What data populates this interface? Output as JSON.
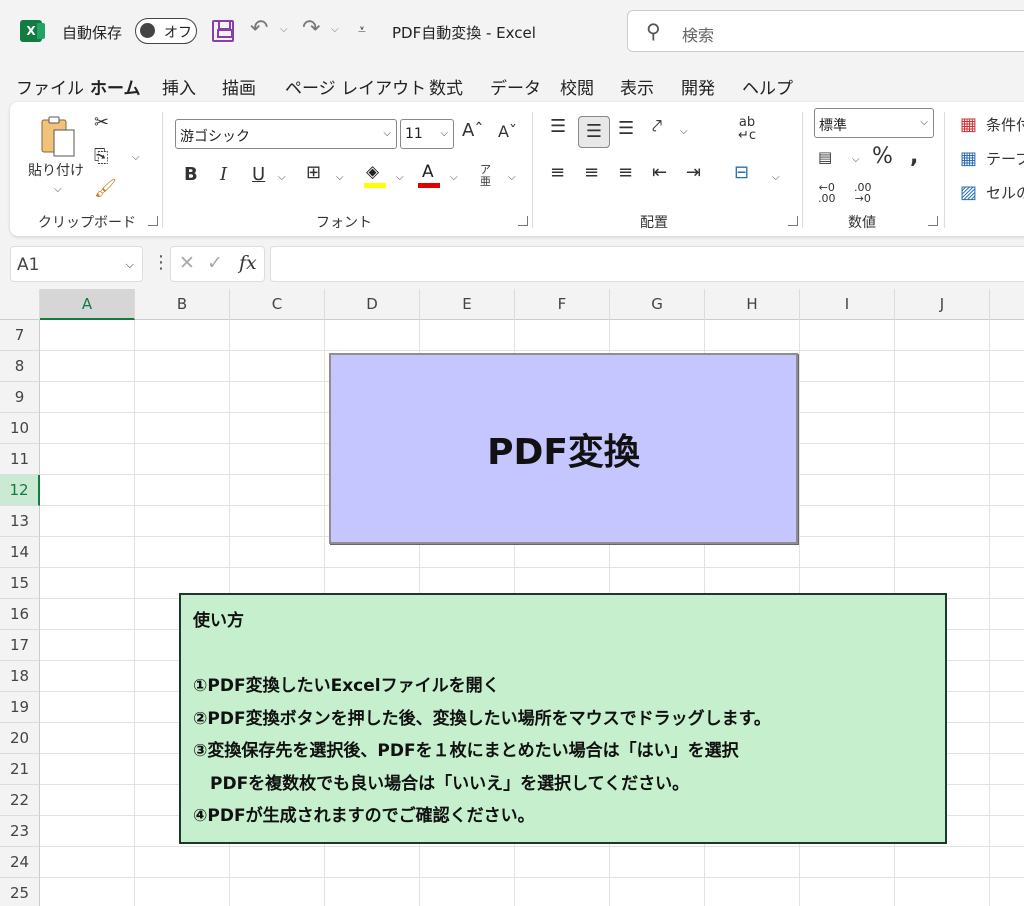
{
  "titlebar": {
    "autosave_label": "自動保存",
    "autosave_state": "オフ",
    "doc_title": "PDF自動変換  -  Excel",
    "search_placeholder": "検索"
  },
  "menu_tabs": [
    "ファイル",
    "ホーム",
    "挿入",
    "描画",
    "ページ レイアウト",
    "数式",
    "データ",
    "校閲",
    "表示",
    "開発",
    "ヘルプ"
  ],
  "active_tab": "ホーム",
  "ribbon": {
    "clipboard": {
      "label": "クリップボード",
      "paste": "貼り付け"
    },
    "font": {
      "label": "フォント",
      "font_name": "游ゴシック",
      "font_size": "11",
      "highlight_color": "#ffff00",
      "font_color": "#e00000"
    },
    "alignment": {
      "label": "配置"
    },
    "number": {
      "label": "数値",
      "format": "標準"
    },
    "styles": {
      "conditional": "条件付",
      "table": "テーブ",
      "cell": "セルの"
    }
  },
  "formula_bar": {
    "name_box": "A1",
    "fx": "fx",
    "content": ""
  },
  "grid": {
    "columns": [
      "A",
      "B",
      "C",
      "D",
      "E",
      "F",
      "G",
      "H",
      "I",
      "J"
    ],
    "rows": [
      "7",
      "8",
      "9",
      "10",
      "11",
      "12",
      "13",
      "14",
      "15",
      "16",
      "17",
      "18",
      "19",
      "20",
      "21",
      "22",
      "23",
      "24",
      "25"
    ],
    "selected_column": "A",
    "selected_row": "12"
  },
  "shapes": {
    "pdf_button": {
      "label": "PDF変換",
      "fill": "#c5c5ff"
    },
    "instructions": {
      "fill": "#c6efce",
      "lines": [
        "使い方",
        "",
        "①PDF変換したいExcelファイルを開く",
        "②PDF変換ボタンを押した後、変換したい場所をマウスでドラッグします。",
        "③変換保存先を選択後、PDFを１枚にまとめたい場合は「はい」を選択",
        "　PDFを複数枚でも良い場合は「いいえ」を選択してください。",
        "④PDFが生成されますのでご確認ください。"
      ]
    }
  }
}
